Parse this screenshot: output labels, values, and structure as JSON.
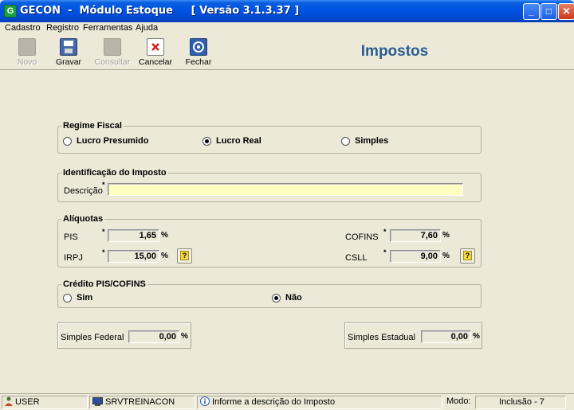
{
  "window": {
    "title": "GECON  -  Módulo Estoque     [ Versão 3.1.3.37 ]",
    "app_icon": "G",
    "minimize": "_",
    "maximize": "□",
    "close": "✕"
  },
  "menu": [
    "Cadastro",
    "Registro",
    "Ferramentas",
    "Ajuda"
  ],
  "toolbar": {
    "buttons": [
      {
        "label": "Novo",
        "icon": "new-icon",
        "enabled": false
      },
      {
        "label": "Gravar",
        "icon": "floppy-icon",
        "enabled": true
      },
      {
        "label": "Consultar",
        "icon": "search-icon",
        "enabled": false
      },
      {
        "label": "Cancelar",
        "icon": "cancel-icon",
        "enabled": true
      },
      {
        "label": "Fechar",
        "icon": "power-icon",
        "enabled": true
      }
    ],
    "page_title": "Impostos"
  },
  "regime": {
    "legend": "Regime Fiscal",
    "options": [
      "Lucro Presumido",
      "Lucro Real",
      "Simples"
    ],
    "selected": "Lucro Real"
  },
  "identificacao": {
    "legend": "Identificação do Imposto",
    "descricao_label": "Descrição",
    "descricao_value": "",
    "required_mark": "*"
  },
  "aliquotas": {
    "legend": "Alíquotas",
    "pis": {
      "label": "PIS",
      "value": "1,65"
    },
    "irpj": {
      "label": "IRPJ",
      "value": "15,00"
    },
    "cofins": {
      "label": "COFINS",
      "value": "7,60"
    },
    "csll": {
      "label": "CSLL",
      "value": "9,00"
    },
    "percent": "%",
    "help": "?"
  },
  "credito": {
    "legend": "Crédito PIS/COFINS",
    "options": [
      "Sim",
      "Não"
    ],
    "selected": "Não"
  },
  "simples": {
    "federal": {
      "label": "Simples Federal",
      "value": "0,00"
    },
    "estadual": {
      "label": "Simples Estadual",
      "value": "0,00"
    }
  },
  "status": {
    "user": "USER",
    "server": "SRVTREINACON",
    "message": "Informe a descrição do Imposto",
    "mode_label": "Modo:",
    "mode_value": "Inclusão - 7"
  },
  "colors": {
    "title_blue": "#2a5d94",
    "input_yellow": "#ffffc1"
  }
}
